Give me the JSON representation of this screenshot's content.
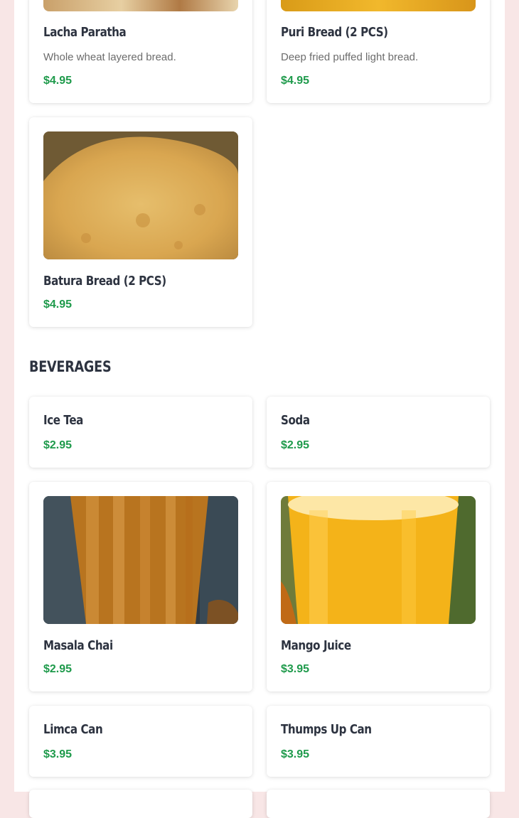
{
  "breads": [
    {
      "name": "Lacha Paratha",
      "description": "Whole wheat layered bread.",
      "price": "$4.95"
    },
    {
      "name": "Puri Bread (2 PCS)",
      "description": "Deep fried puffed light bread.",
      "price": "$4.95"
    },
    {
      "name": "Batura Bread (2 PCS)",
      "price": "$4.95"
    }
  ],
  "beverages": {
    "title": "BEVERAGES",
    "items": [
      {
        "name": "Ice Tea",
        "price": "$2.95"
      },
      {
        "name": "Soda",
        "price": "$2.95"
      },
      {
        "name": "Masala Chai",
        "price": "$2.95"
      },
      {
        "name": "Mango Juice",
        "price": "$3.95"
      },
      {
        "name": "Limca Can",
        "price": "$3.95"
      },
      {
        "name": "Thumps Up Can",
        "price": "$3.95"
      }
    ]
  },
  "colors": {
    "price": "#1e9a4b",
    "title": "#2d3340",
    "page_background": "#f8e6e6"
  }
}
